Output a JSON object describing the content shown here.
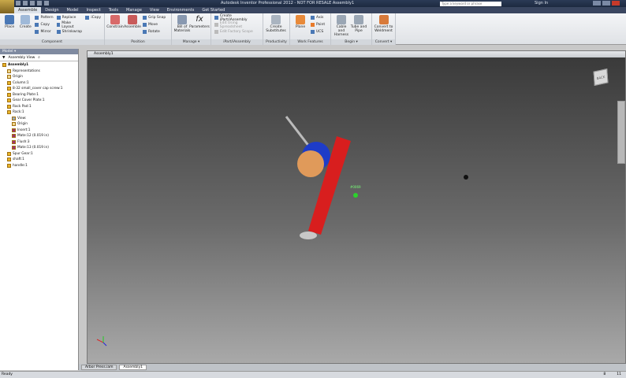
{
  "app": {
    "title": "Autodesk Inventor Professional 2012 - NOT FOR RESALE   Assembly1",
    "search_placeholder": "Type a keyword or phrase",
    "sign_in": "Sign In"
  },
  "tabs": [
    "Assemble",
    "Design",
    "Model",
    "Inspect",
    "Tools",
    "Manage",
    "View",
    "Environments",
    "Get Started"
  ],
  "ribbon": {
    "component": {
      "label": "Component",
      "place": "Place",
      "create": "Create",
      "pattern": "Pattern",
      "copy": "Copy",
      "mirror": "Mirror",
      "replace": "Replace",
      "make_layout": "Make Layout",
      "shrinkwrap": "Shrinkwrap",
      "icopy": "iCopy"
    },
    "position": {
      "label": "Position",
      "constrain": "Constrain",
      "assemble": "Assemble",
      "grip_snap": "Grip Snap",
      "move": "Move",
      "rotate": "Rotate"
    },
    "manage": {
      "label": "Manage ▾",
      "bom": "Bill of Materials",
      "parameters": "Parameters"
    },
    "ipart": {
      "label": "iPart/iAssembly",
      "create": "Create iPart/iAssembly",
      "edit_factory": "Edit Using Spreadsheet",
      "edit_member": "Edit Factory Scope"
    },
    "productivity": {
      "label": "Productivity",
      "create_subs": "Create Substitutes"
    },
    "work": {
      "label": "Work Features",
      "plane": "Plane",
      "axis": "Axis",
      "point": "Point",
      "ucs": "UCS"
    },
    "begin": {
      "label": "Begin ▾",
      "cable": "Cable and Harness",
      "tube": "Tube and Pipe"
    },
    "convert": {
      "label": "Convert ▾",
      "weldment": "Convert to Weldment"
    }
  },
  "browser": {
    "header": "Model ▾",
    "view": "Assembly View",
    "tree": [
      {
        "label": "Assembly1",
        "level": 0,
        "icon": "assembly"
      },
      {
        "label": "Representations",
        "level": 1,
        "icon": "folder"
      },
      {
        "label": "Origin",
        "level": 1,
        "icon": "folder"
      },
      {
        "label": "Column:1",
        "level": 1,
        "icon": "part"
      },
      {
        "label": "8-32 small_cover cap screw:1",
        "level": 1,
        "icon": "part"
      },
      {
        "label": "Bearing Plate:1",
        "level": 1,
        "icon": "part"
      },
      {
        "label": "Gear Cover Plate:1",
        "level": 1,
        "icon": "part"
      },
      {
        "label": "Rack Pad:1",
        "level": 1,
        "icon": "part"
      },
      {
        "label": "Rack:1",
        "level": 1,
        "icon": "part"
      },
      {
        "label": "View:",
        "level": 2,
        "icon": "view"
      },
      {
        "label": "Origin",
        "level": 2,
        "icon": "folder"
      },
      {
        "label": "Insert:1",
        "level": 2,
        "icon": "constraint"
      },
      {
        "label": "Mate:12 (0.019 in)",
        "level": 2,
        "icon": "constraint"
      },
      {
        "label": "Flush:3",
        "level": 2,
        "icon": "constraint"
      },
      {
        "label": "Mate:13 (0.019 in)",
        "level": 2,
        "icon": "constraint"
      },
      {
        "label": "Spur Gear:1",
        "level": 1,
        "icon": "part"
      },
      {
        "label": "shaft:1",
        "level": 1,
        "icon": "part"
      },
      {
        "label": "handle:1",
        "level": 1,
        "icon": "part"
      }
    ]
  },
  "viewport": {
    "title": "Assembly1",
    "viewcube": "BACK",
    "tag": "#0069"
  },
  "doc_tabs": [
    "Arbor Press.iam",
    "Assembly1"
  ],
  "status": {
    "text": "Ready",
    "right": [
      "8",
      "11"
    ]
  },
  "colors": {
    "rack": "#d81e1e",
    "gear": "#1e3cc8",
    "plate": "#e09a5a",
    "accent": "#3a4660"
  }
}
